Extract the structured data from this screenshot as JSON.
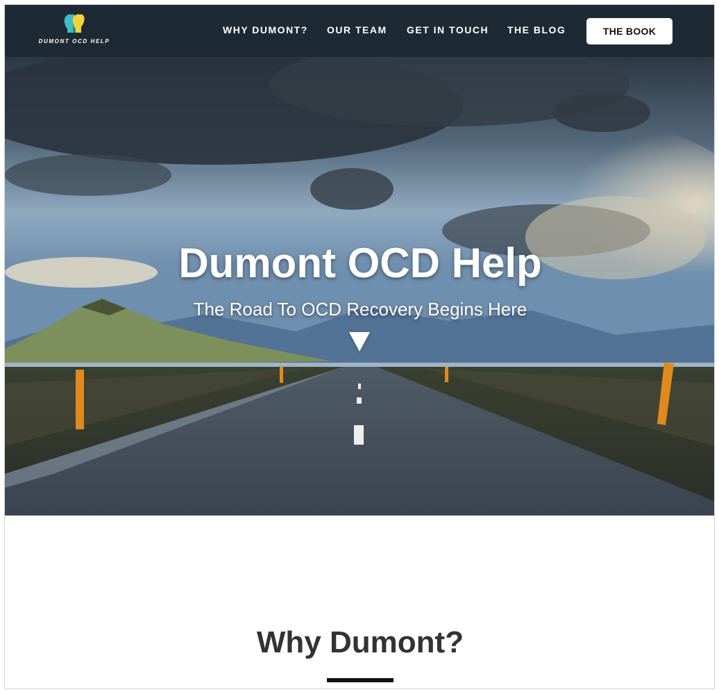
{
  "brand": {
    "name": "DUMONT OCD HELP"
  },
  "nav": {
    "links": [
      "WHY DUMONT?",
      "OUR TEAM",
      "GET IN TOUCH",
      "THE BLOG"
    ],
    "cta": "THE BOOK"
  },
  "hero": {
    "title": "Dumont OCD Help",
    "subtitle": "The Road To OCD Recovery Begins Here"
  },
  "section": {
    "title": "Why Dumont?"
  },
  "colors": {
    "nav_bg": "#1e2a33",
    "cta_bg": "#ffffff",
    "heading": "#333333",
    "logo_left_head": "#3fbcc4",
    "logo_right_head": "#f2d43a"
  },
  "icons": [
    "logo-heads-icon",
    "down-arrow-icon"
  ]
}
